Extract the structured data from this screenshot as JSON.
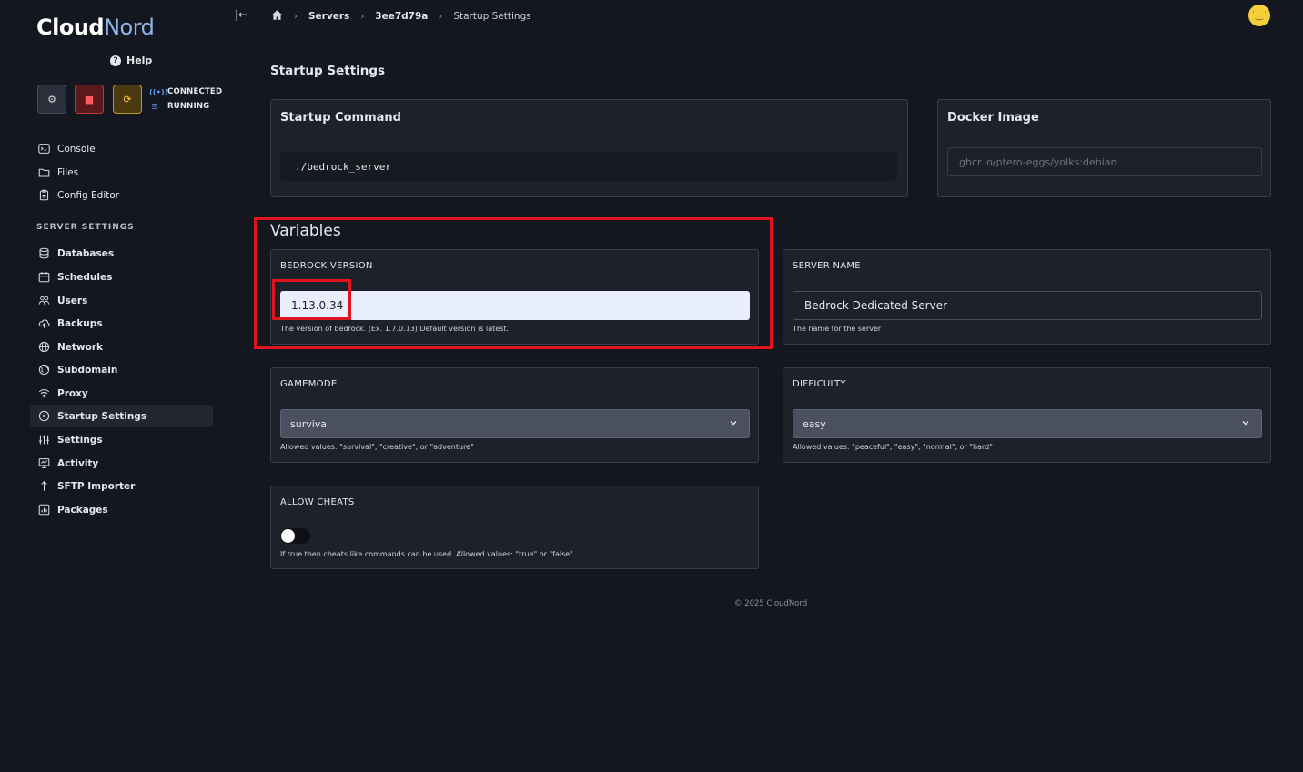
{
  "brand": {
    "name_part1": "Cloud",
    "name_part2": "Nord"
  },
  "help_label": "Help",
  "status": {
    "connection": "CONNECTED",
    "state": "RUNNING"
  },
  "nav": {
    "items": [
      {
        "label": "Console",
        "icon": "terminal-icon"
      },
      {
        "label": "Files",
        "icon": "folder-icon"
      },
      {
        "label": "Config Editor",
        "icon": "clipboard-icon"
      }
    ],
    "section_title": "SERVER SETTINGS",
    "settings_items": [
      {
        "label": "Databases",
        "icon": "database-icon"
      },
      {
        "label": "Schedules",
        "icon": "calendar-icon"
      },
      {
        "label": "Users",
        "icon": "users-icon"
      },
      {
        "label": "Backups",
        "icon": "cloud-upload-icon"
      },
      {
        "label": "Network",
        "icon": "globe-icon"
      },
      {
        "label": "Subdomain",
        "icon": "globe-alt-icon"
      },
      {
        "label": "Proxy",
        "icon": "wifi-icon"
      },
      {
        "label": "Startup Settings",
        "icon": "play-circle-icon"
      },
      {
        "label": "Settings",
        "icon": "sliders-icon"
      },
      {
        "label": "Activity",
        "icon": "monitor-icon"
      },
      {
        "label": "SFTP Importer",
        "icon": "arrow-up-icon"
      },
      {
        "label": "Packages",
        "icon": "chart-box-icon"
      }
    ],
    "active": "Startup Settings"
  },
  "breadcrumb": {
    "servers": "Servers",
    "server_id": "3ee7d79a",
    "current": "Startup Settings"
  },
  "page_title": "Startup Settings",
  "startup_command": {
    "title": "Startup Command",
    "value": "./bedrock_server"
  },
  "docker_image": {
    "title": "Docker Image",
    "value": "ghcr.io/ptero-eggs/yolks:debian"
  },
  "variables": {
    "title": "Variables",
    "bedrock_version": {
      "label": "BEDROCK VERSION",
      "value": "1.13.0.34",
      "help": "The version of bedrock. (Ex. 1.7.0.13) Default version is latest."
    },
    "server_name": {
      "label": "SERVER NAME",
      "value": "Bedrock Dedicated Server",
      "help": "The name for the server"
    },
    "gamemode": {
      "label": "GAMEMODE",
      "value": "survival",
      "help": "Allowed values: \"survival\", \"creative\", or \"adventure\""
    },
    "difficulty": {
      "label": "DIFFICULTY",
      "value": "easy",
      "help": "Allowed values: \"peaceful\", \"easy\", \"normal\", or \"hard\""
    },
    "allow_cheats": {
      "label": "ALLOW CHEATS",
      "value": "false",
      "help": "If true then cheats like commands can be used. Allowed values: \"true\" or \"false\""
    }
  },
  "footer": "© 2025 CloudNord",
  "colors": {
    "background": "#14171f",
    "card": "#1d212a",
    "highlight": "#e0141e",
    "accent": "#5b9bf0"
  }
}
